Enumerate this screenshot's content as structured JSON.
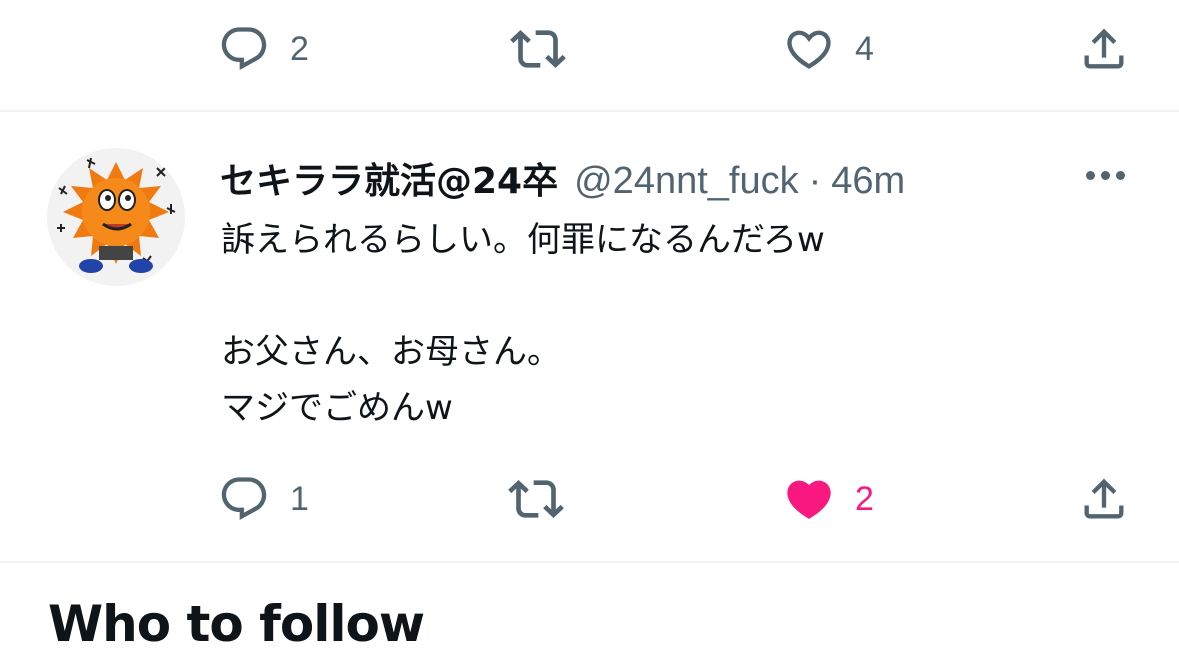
{
  "previous_tweet": {
    "reply_count": "2",
    "retweet_count": "",
    "like_count": "4"
  },
  "tweet": {
    "display_name": "セキララ就活@24卒",
    "handle": "@24nnt_fuck",
    "separator": "·",
    "time": "46m",
    "text_line1": "訴えられるらしい。何罪になるんだろw",
    "text_line2": "",
    "text_line3": "お父さん、お母さん。",
    "text_line4": "マジでごめんw",
    "reply_count": "1",
    "retweet_count": "",
    "like_count": "2",
    "liked": true
  },
  "who_to_follow": {
    "title": "Who to follow"
  },
  "colors": {
    "secondary_text": "#536471",
    "like_active": "#f91880",
    "primary_text": "#0f1419",
    "divider": "#eff3f4"
  },
  "icons": [
    "reply-icon",
    "retweet-icon",
    "like-icon",
    "share-icon",
    "more-icon"
  ]
}
